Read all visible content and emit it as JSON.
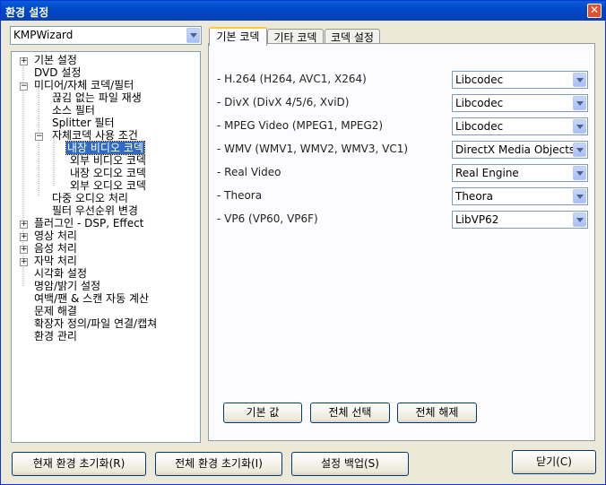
{
  "window": {
    "title": "환경 설정",
    "close_label": "✕"
  },
  "preset": {
    "selected": "KMPWizard"
  },
  "tree": [
    {
      "label": "기본 설정"
    },
    {
      "label": "DVD 설정"
    },
    {
      "label": "미디어/자체 코덱/필터"
    },
    {
      "label": "끊김 없는 파일 재생"
    },
    {
      "label": "소스 필터"
    },
    {
      "label": "Splitter 필터"
    },
    {
      "label": "자체코덱 사용 조건"
    },
    {
      "label": "내장 비디오 코덱"
    },
    {
      "label": "외부 비디오 코덱"
    },
    {
      "label": "내장 오디오 코덱"
    },
    {
      "label": "외부 오디오 코덱"
    },
    {
      "label": "다중 오디오 처리"
    },
    {
      "label": "필터 우선순위 변경"
    },
    {
      "label": "플러그인 - DSP, Effect"
    },
    {
      "label": "영상 처리"
    },
    {
      "label": "음성 처리"
    },
    {
      "label": "자막 처리"
    },
    {
      "label": "시각화 설정"
    },
    {
      "label": "명암/밝기 설정"
    },
    {
      "label": "여백/팬 & 스캔 자동 계산"
    },
    {
      "label": "문제 해결"
    },
    {
      "label": "확장자 정의/파일 연결/캡쳐"
    },
    {
      "label": "환경 관리"
    }
  ],
  "tabs": [
    {
      "label": "기본 코덱"
    },
    {
      "label": "기타 코덱"
    },
    {
      "label": "코덱 설정"
    }
  ],
  "codecs": [
    {
      "label": "- H.264 (H264, AVC1, X264)",
      "value": "Libcodec"
    },
    {
      "label": "- DivX (DivX 4/5/6, XviD)",
      "value": "Libcodec"
    },
    {
      "label": "- MPEG Video (MPEG1, MPEG2)",
      "value": "Libcodec"
    },
    {
      "label": "- WMV (WMV1, WMV2, WMV3, VC1)",
      "value": "DirectX Media Objects"
    },
    {
      "label": "- Real Video",
      "value": "Real Engine"
    },
    {
      "label": "- Theora",
      "value": "Theora"
    },
    {
      "label": "- VP6 (VP60, VP6F)",
      "value": "LibVP62"
    }
  ],
  "panel_buttons": {
    "default": "기본 값",
    "select_all": "전체 선택",
    "deselect_all": "전체 해제"
  },
  "footer": {
    "reset_current": "현재 환경 초기화(R)",
    "reset_all": "전체 환경 초기화(I)",
    "backup": "설정 백업(S)",
    "close": "닫기(C)"
  }
}
